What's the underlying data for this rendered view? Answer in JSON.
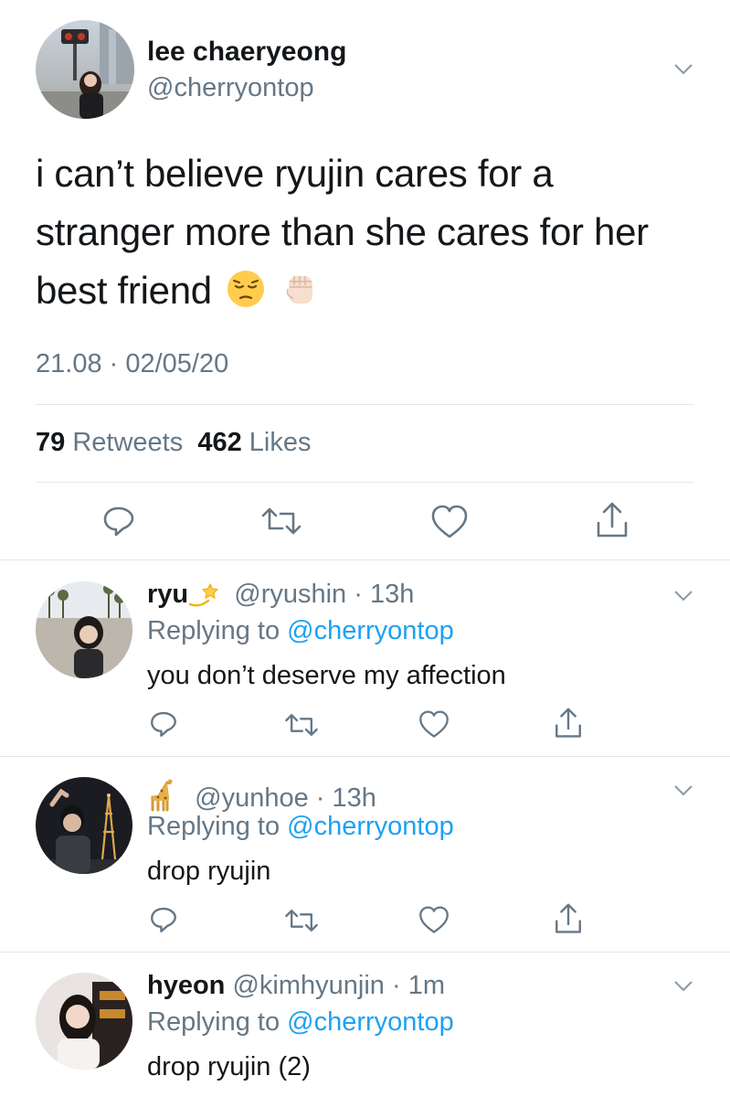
{
  "tweet": {
    "author_name": "lee chaeryeong",
    "author_handle": "@cherryontop",
    "text": "i can’t believe ryujin cares for a stranger more than she cares for her best friend",
    "emojis": [
      "pensive-face",
      "raised-fist"
    ],
    "timestamp": "21.08 · 02/05/20",
    "retweets_count": "79",
    "retweets_label": "Retweets",
    "likes_count": "462",
    "likes_label": "Likes"
  },
  "replies": [
    {
      "name": "ryu",
      "name_emoji": "dizzy-star",
      "handle": "@ryushin",
      "time": "· 13h",
      "replying_prefix": "Replying to",
      "replying_handle": "@cherryontop",
      "text": "you don’t deserve my affection"
    },
    {
      "name": "",
      "name_emoji": "giraffe",
      "handle": "@yunhoe",
      "time": "· 13h",
      "replying_prefix": "Replying to",
      "replying_handle": "@cherryontop",
      "text": "drop ryujin"
    },
    {
      "name": "hyeon",
      "name_emoji": "",
      "handle": "@kimhyunjin",
      "time": "· 1m",
      "replying_prefix": "Replying to",
      "replying_handle": "@cherryontop",
      "text": "drop ryujin (2)"
    }
  ],
  "colors": {
    "text": "#14171a",
    "secondary": "#657786",
    "link": "#1da1f2",
    "divider": "#e1e8ed"
  }
}
